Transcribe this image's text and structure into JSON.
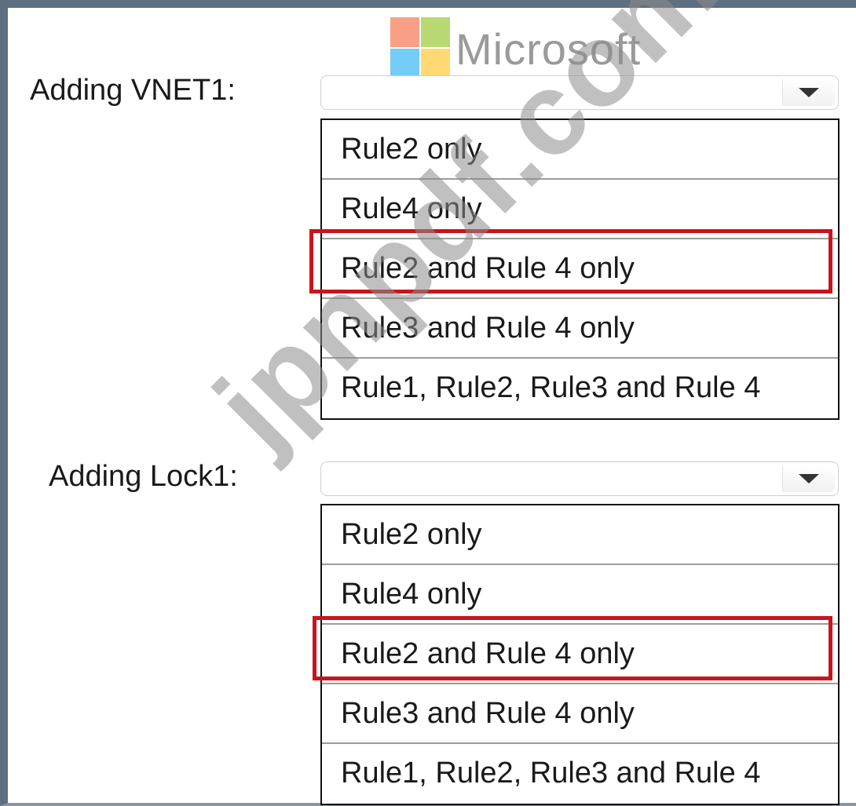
{
  "logo": {
    "text": "Microsoft",
    "colors": [
      "#f25022",
      "#7fba00",
      "#00a4ef",
      "#ffb900"
    ]
  },
  "watermark": {
    "text": "jpnpdf.com"
  },
  "questions": [
    {
      "label": "Adding VNET1:",
      "dropdown_icon": "chevron-down-icon",
      "options": [
        "Rule2 only",
        "Rule4 only",
        "Rule2 and Rule 4 only",
        "Rule3 and Rule 4 only",
        "Rule1, Rule2, Rule3 and Rule 4"
      ],
      "highlighted_option": "Rule2 and Rule 4 only"
    },
    {
      "label": "Adding Lock1:",
      "dropdown_icon": "chevron-down-icon",
      "options": [
        "Rule2 only",
        "Rule4 only",
        "Rule2 and Rule 4 only",
        "Rule3 and Rule 4 only",
        "Rule1, Rule2, Rule3 and Rule 4"
      ],
      "highlighted_option": "Rule2 and Rule 4 only"
    }
  ],
  "colors": {
    "frame": "#5f6f82",
    "highlight": "#c8141e"
  }
}
